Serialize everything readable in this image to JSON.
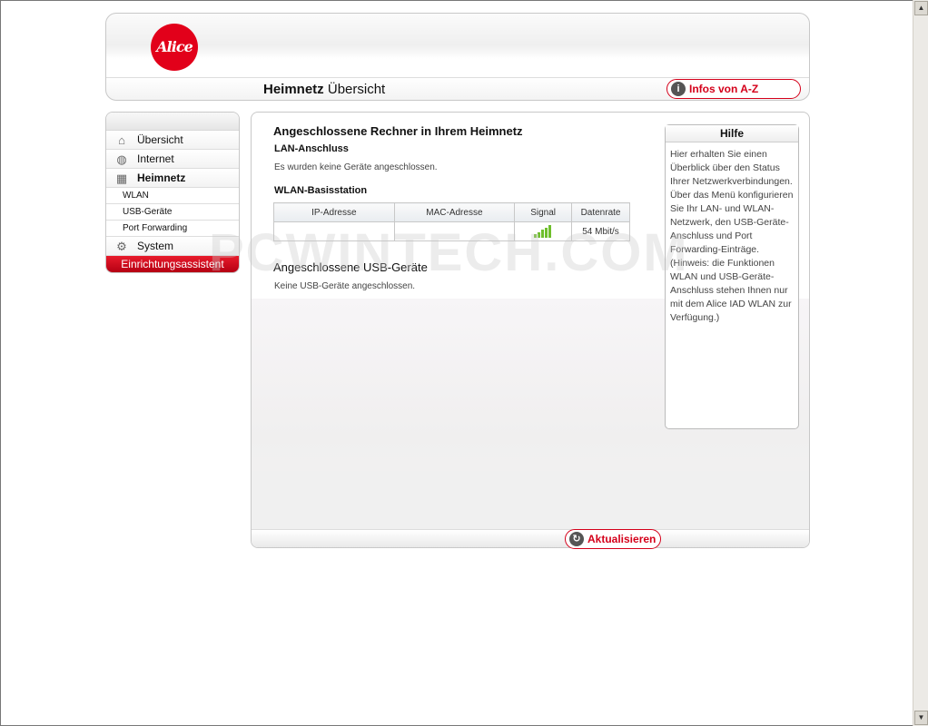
{
  "header": {
    "logo_text": "Alice",
    "title_bold": "Heimnetz",
    "title_rest": "Übersicht",
    "infos_label": "Infos von A-Z"
  },
  "sidebar": {
    "items": [
      {
        "label": "Übersicht",
        "icon": "home-icon"
      },
      {
        "label": "Internet",
        "icon": "globe-icon"
      },
      {
        "label": "Heimnetz",
        "icon": "network-icon",
        "active": true
      }
    ],
    "subitems": [
      "WLAN",
      "USB-Geräte",
      "Port Forwarding"
    ],
    "system_label": "System",
    "wizard_label": "Einrichtungsassistent"
  },
  "main": {
    "heading": "Angeschlossene Rechner in Ihrem Heimnetz",
    "lan_heading": "LAN-Anschluss",
    "lan_text": "Es wurden keine Geräte angeschlossen.",
    "wlan_heading": "WLAN-Basisstation",
    "table": {
      "headers": [
        "IP-Adresse",
        "MAC-Adresse",
        "Signal",
        "Datenrate"
      ],
      "rows": [
        {
          "ip": "",
          "mac": "",
          "signal_bars": 5,
          "rate": "54 Mbit/s"
        }
      ]
    },
    "usb_heading": "Angeschlossene USB-Geräte",
    "usb_text": "Keine USB-Geräte angeschlossen.",
    "refresh_label": "Aktualisieren"
  },
  "help": {
    "title": "Hilfe",
    "text": "Hier erhalten Sie einen Überblick über den Status Ihrer Netzwerkverbindungen. Über das Menü konfigurieren Sie Ihr LAN- und WLAN-Netzwerk, den USB-Geräte-Anschluss und Port Forwarding-Einträge. (Hinweis: die Funktionen WLAN und USB-Geräte-Anschluss stehen Ihnen nur mit dem Alice IAD WLAN zur Verfügung.)"
  },
  "watermark": "PCWINTECH.COM",
  "colors": {
    "brand_red": "#e2001a",
    "signal_green": "#6fbf2c"
  }
}
